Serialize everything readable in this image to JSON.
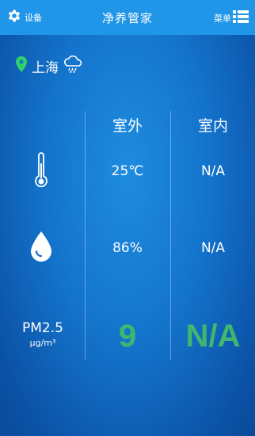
{
  "header": {
    "settings_label": "设备",
    "title": "净养管家",
    "menu_label": "菜单"
  },
  "location": {
    "city": "上海",
    "weather_icon": "cloud-rain-icon"
  },
  "columns": {
    "outdoor": "室外",
    "indoor": "室内"
  },
  "rows": {
    "temperature": {
      "icon": "thermometer-icon",
      "outdoor": "25℃",
      "indoor": "N/A"
    },
    "humidity": {
      "icon": "water-drop-icon",
      "outdoor": "86%",
      "indoor": "N/A"
    },
    "pm25": {
      "label": "PM2.5",
      "unit": "μg/m³",
      "outdoor": "9",
      "indoor": "N/A"
    }
  },
  "colors": {
    "header_bg": "#2196e8",
    "location_pin": "#2fd36b",
    "pm_value": "#3fb86e"
  }
}
